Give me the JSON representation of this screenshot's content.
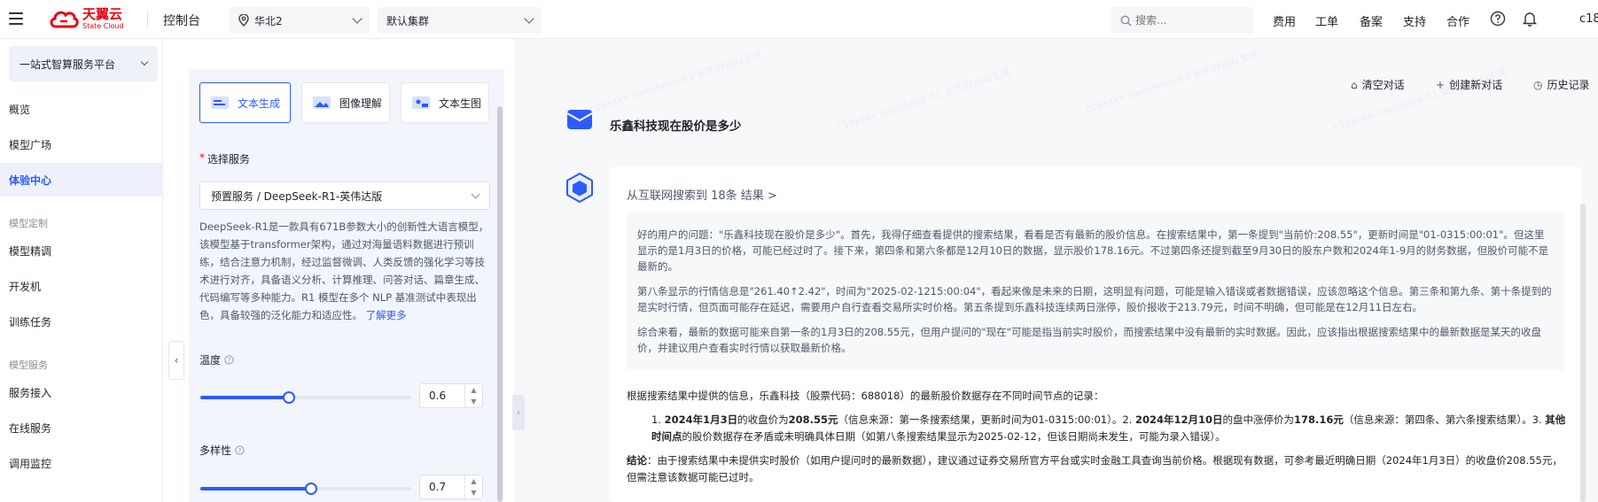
{
  "brand": {
    "name_cn": "天翼云",
    "name_en": "State Cloud",
    "color": "#e60012"
  },
  "topbar": {
    "console": "控制台",
    "region": "华北2",
    "cluster": "默认集群",
    "search_placeholder": "搜索...",
    "links": [
      "费用",
      "工单",
      "备案",
      "支持",
      "合作"
    ],
    "user": "c18"
  },
  "sidebar": {
    "platform": "一站式智算服务平台",
    "items": [
      "概览",
      "模型广场",
      "体验中心"
    ],
    "group_custom": "模型定制",
    "custom_items": [
      "模型精调",
      "开发机",
      "训练任务"
    ],
    "group_service": "模型服务",
    "service_items": [
      "服务接入",
      "在线服务",
      "调用监控"
    ],
    "active": "体验中心"
  },
  "panel": {
    "tabs": [
      "文本生成",
      "图像理解",
      "文本生图"
    ],
    "active_tab": "文本生成",
    "service_label_required": "*",
    "service_label": "选择服务",
    "service_value": "预置服务 / DeepSeek-R1-英伟达版",
    "description": "DeepSeek-R1是一款具有671B参数大小的创新性大语言模型，该模型基于transformer架构，通过对海量语料数据进行预训练，结合注意力机制，经过监督微调、人类反馈的强化学习等技术进行对齐，具备语义分析、计算推理、问答对话、篇章生成、代码编写等多种能力。R1 模型在多个 NLP 基准测试中表现出色，具备较强的泛化能力和适应性。",
    "learn_more": "了解更多",
    "temperature_label": "温度",
    "temperature_value": "0.6",
    "temperature_fraction": 0.6,
    "diversity_label": "多样性",
    "diversity_value": "0.7",
    "diversity_fraction": 0.7
  },
  "chat": {
    "actions": [
      "清空对话",
      "创建新对话",
      "历史记录"
    ],
    "question": "乐鑫科技现在股价是多少",
    "search_result": "从互联网搜索到 18条 结果 >",
    "thinking": [
      "好的用户的问题：\"乐鑫科技现在股价是多少\"。首先，我得仔细查看提供的搜索结果，看看是否有最新的股价信息。在搜索结果中，第一条提到\"当前价:208.55\"，更新时间是\"01-0315:00:01\"。但这里显示的是1月3日的价格，可能已经过时了。接下来，第四条和第六条都是12月10日的数据，显示股价178.16元。不过第四条还提到截至9月30日的股东户数和2024年1-9月的财务数据，但股价可能不是最新的。",
      "第八条显示的行情信息是\"261.40↑2.42\"，时间为\"2025-02-1215:00:04\"，看起来像是未来的日期，这明显有问题，可能是输入错误或者数据错误，应该忽略这个信息。第三条和第九条、第十条提到的是实时行情，但页面可能存在延迟，需要用户自行查看交易所实时价格。第五条提到乐鑫科技连续两日涨停，股价报收于213.79元，时间不明确，但可能是在12月11日左右。",
      "综合来看，最新的数据可能来自第一条的1月3日的208.55元，但用户提问的\"现在\"可能是指当前实时股价，而搜索结果中没有最新的实时数据。因此，应该指出根据搜索结果中的最新数据是某天的收盘价，并建议用户查看实时行情以获取最新价格。"
    ],
    "final_intro": "根据搜索结果中提供的信息，乐鑫科技（股票代码：688018）的最新股价数据存在不同时间节点的记录：",
    "list_1a": "1. ",
    "list_1b": "2024年1月3日",
    "list_1c": "的收盘价为",
    "list_1d": "208.55元",
    "list_1e": "（信息来源：第一条搜索结果，更新时间为01-0315:00:01）。2. ",
    "list_1f": "2024年12月10日",
    "list_1g": "的盘中涨停价为",
    "list_1h": "178.16元",
    "list_1i": "（信息来源：第四条、第六条搜索结果）。3. ",
    "list_1j": "其他时间点",
    "list_1k": "的股价数据存在矛盾或未明确具体日期（如第八条搜索结果显示为2025-02-12，但该日期尚未发生，可能为录入错误）。",
    "conclusion_label": "结论",
    "conclusion": "：由于搜索结果中未提供实时股价（如用户提问时的最新数据），建议通过证券交易所官方平台或实时金融工具查询当前价格。根据现有数据，可参考最近明确日期（2024年1月3日）的收盘价208.55元，但需注意该数据可能已过时。"
  },
  "colors": {
    "accent": "#2d5bff",
    "brand": "#e60012"
  }
}
